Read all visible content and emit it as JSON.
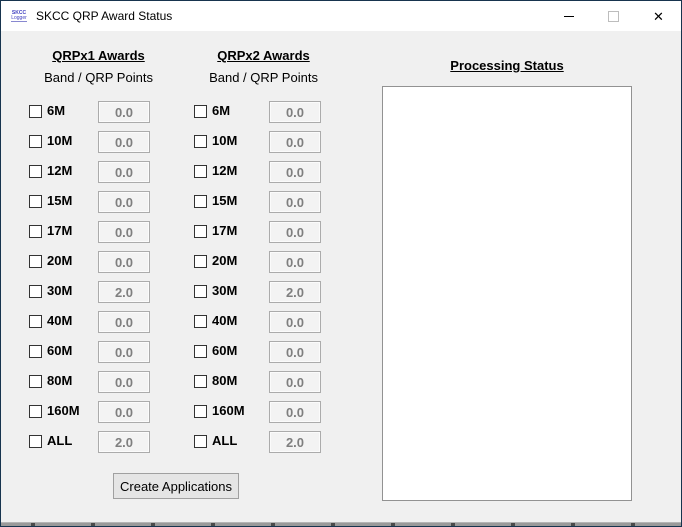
{
  "window": {
    "title": "SKCC QRP Award Status",
    "icon": {
      "line1": "SKCC",
      "line2": "Logger"
    },
    "controls": {
      "close_glyph": "✕"
    }
  },
  "award_columns": [
    {
      "header": "QRPx1 Awards",
      "subheader": "Band / QRP Points",
      "rows": [
        {
          "band": "6M",
          "points": "0.0",
          "checked": false
        },
        {
          "band": "10M",
          "points": "0.0",
          "checked": false
        },
        {
          "band": "12M",
          "points": "0.0",
          "checked": false
        },
        {
          "band": "15M",
          "points": "0.0",
          "checked": false
        },
        {
          "band": "17M",
          "points": "0.0",
          "checked": false
        },
        {
          "band": "20M",
          "points": "0.0",
          "checked": false
        },
        {
          "band": "30M",
          "points": "2.0",
          "checked": false
        },
        {
          "band": "40M",
          "points": "0.0",
          "checked": false
        },
        {
          "band": "60M",
          "points": "0.0",
          "checked": false
        },
        {
          "band": "80M",
          "points": "0.0",
          "checked": false
        },
        {
          "band": "160M",
          "points": "0.0",
          "checked": false
        },
        {
          "band": "ALL",
          "points": "2.0",
          "checked": false
        }
      ]
    },
    {
      "header": "QRPx2 Awards",
      "subheader": "Band / QRP Points",
      "rows": [
        {
          "band": "6M",
          "points": "0.0",
          "checked": false
        },
        {
          "band": "10M",
          "points": "0.0",
          "checked": false
        },
        {
          "band": "12M",
          "points": "0.0",
          "checked": false
        },
        {
          "band": "15M",
          "points": "0.0",
          "checked": false
        },
        {
          "band": "17M",
          "points": "0.0",
          "checked": false
        },
        {
          "band": "20M",
          "points": "0.0",
          "checked": false
        },
        {
          "band": "30M",
          "points": "2.0",
          "checked": false
        },
        {
          "band": "40M",
          "points": "0.0",
          "checked": false
        },
        {
          "band": "60M",
          "points": "0.0",
          "checked": false
        },
        {
          "band": "80M",
          "points": "0.0",
          "checked": false
        },
        {
          "band": "160M",
          "points": "0.0",
          "checked": false
        },
        {
          "band": "ALL",
          "points": "2.0",
          "checked": false
        }
      ]
    }
  ],
  "processing_status": {
    "header": "Processing Status",
    "content": ""
  },
  "actions": {
    "create_applications": "Create Applications"
  },
  "colors": {
    "window_border": "#17344e",
    "titlebar_bg": "#ffffff",
    "body_bg": "#f0f0f0",
    "field_text": "#7f7f7f",
    "field_border": "#ababab",
    "status_box_bg": "#ffffff",
    "icon_text": "#4040c0"
  }
}
